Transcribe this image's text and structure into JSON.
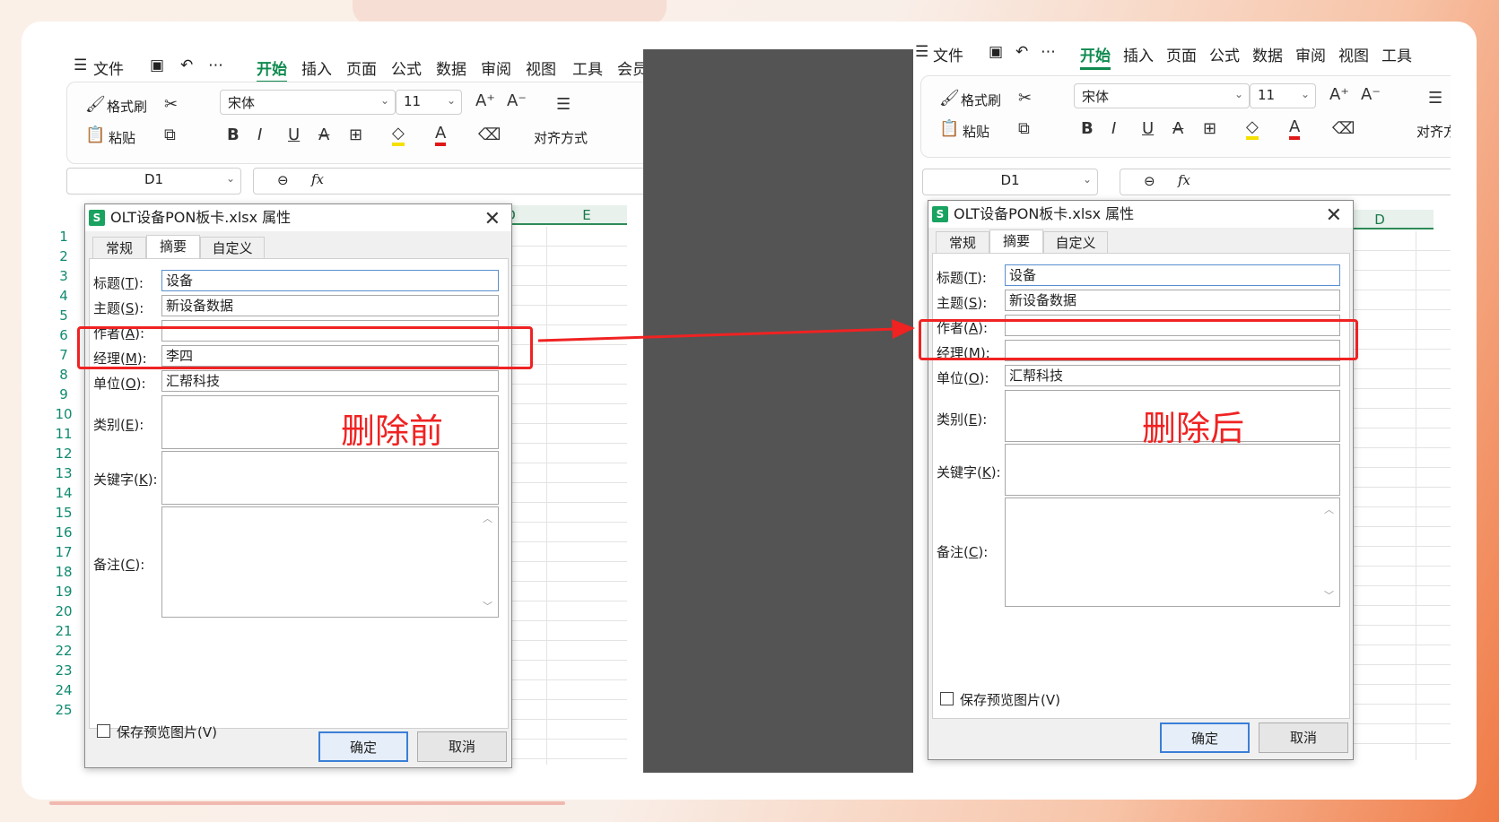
{
  "left_panel": {
    "menu": {
      "file": "文件",
      "items": [
        "开始",
        "插入",
        "页面",
        "公式",
        "数据",
        "审阅",
        "视图",
        "工具",
        "会员"
      ],
      "active": "开始"
    },
    "ribbon": {
      "format_painter": "格式刷",
      "paste": "粘贴",
      "font": "宋体",
      "size": "11",
      "align": "对齐方式"
    },
    "name_box": "D1",
    "fx": "fx",
    "col_headers": [
      "D",
      "E"
    ],
    "rows": [
      "1",
      "2",
      "3",
      "4",
      "5",
      "6",
      "7",
      "8",
      "9",
      "10",
      "11",
      "12",
      "13",
      "14",
      "15",
      "16",
      "17",
      "18",
      "19",
      "20",
      "21",
      "22",
      "23",
      "24",
      "25"
    ]
  },
  "right_panel": {
    "menu": {
      "file": "文件",
      "items": [
        "开始",
        "插入",
        "页面",
        "公式",
        "数据",
        "审阅",
        "视图",
        "工具"
      ],
      "active": "开始"
    },
    "ribbon": {
      "format_painter": "格式刷",
      "paste": "粘贴",
      "font": "宋体",
      "size": "11",
      "align": "对齐方"
    },
    "name_box": "D1",
    "fx": "fx",
    "col_headers": [
      "D"
    ]
  },
  "dialog": {
    "title": "OLT设备PON板卡.xlsx 属性",
    "icon_letter": "S",
    "tabs": [
      "常规",
      "摘要",
      "自定义"
    ],
    "labels": {
      "title": "标题(",
      "title_key": "T",
      "subject": "主题(",
      "subject_key": "S",
      "author": "作者(",
      "author_key": "A",
      "manager": "经理(",
      "manager_key": "M",
      "company": "单位(",
      "company_key": "O",
      "category": "类别(",
      "category_key": "E",
      "keywords": "关键字(",
      "keywords_key": "K",
      "comments": "备注(",
      "comments_key": "C",
      "close": "):"
    },
    "save_preview": "保存预览图片(V)",
    "ok": "确定",
    "cancel": "取消"
  },
  "before": {
    "title": "设备",
    "subject": "新设备数据",
    "author": "",
    "manager": "李四",
    "company": "汇帮科技",
    "caption": "删除前"
  },
  "after": {
    "title": "设备",
    "subject": "新设备数据",
    "author": "",
    "manager": "",
    "company": "汇帮科技",
    "caption": "删除后"
  },
  "colors": {
    "highlight": "#f02222",
    "accent": "#0f8a4f"
  }
}
